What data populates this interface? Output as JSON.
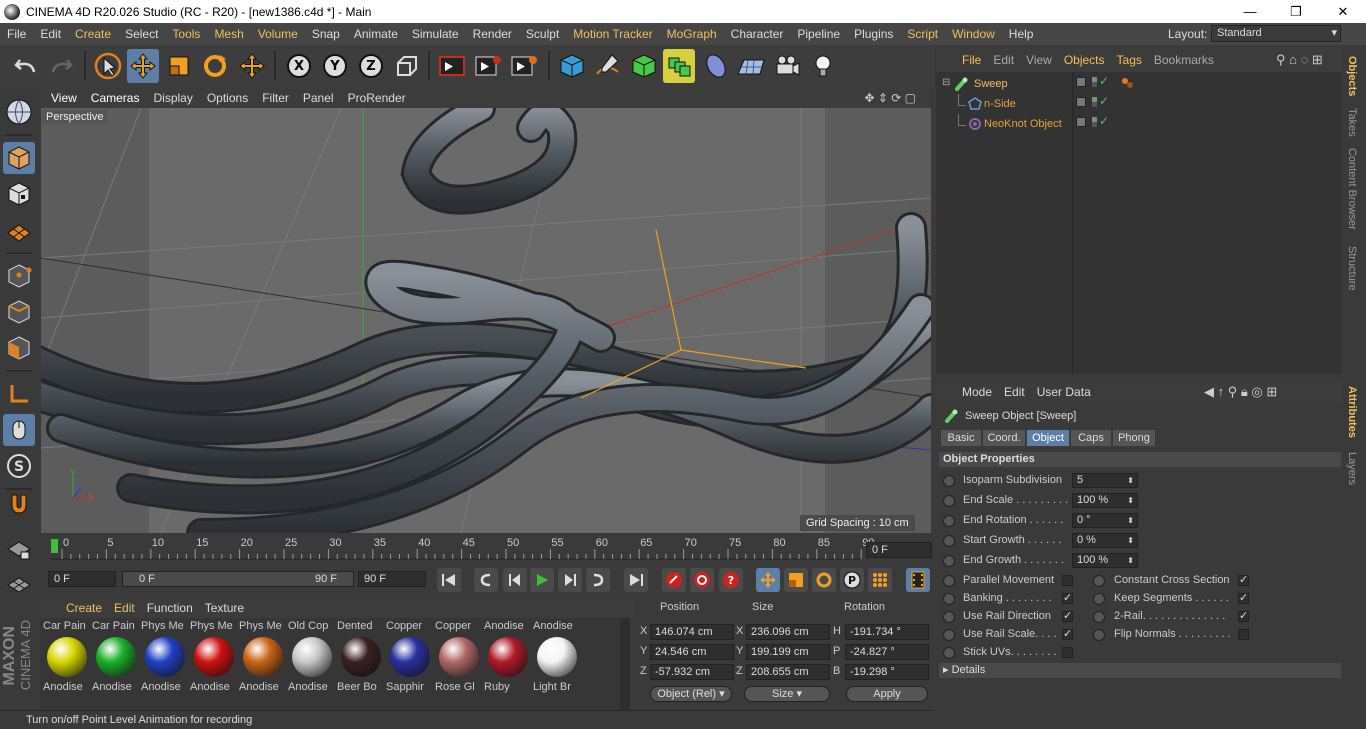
{
  "window": {
    "title": "CINEMA 4D R20.026 Studio (RC - R20) - [new1386.c4d *] - Main",
    "minimize": "—",
    "maximize": "❐",
    "close": "✕"
  },
  "menubar": {
    "items": [
      "File",
      "Edit",
      "Create",
      "Select",
      "Tools",
      "Mesh",
      "Volume",
      "Snap",
      "Animate",
      "Simulate",
      "Render",
      "Sculpt",
      "Motion Tracker",
      "MoGraph",
      "Character",
      "Pipeline",
      "Plugins",
      "Script",
      "Window",
      "Help"
    ],
    "layout_label": "Layout:",
    "layout_value": "Standard"
  },
  "viewport": {
    "menu": [
      "View",
      "Cameras",
      "Display",
      "Options",
      "Filter",
      "Panel",
      "ProRender"
    ],
    "camera_label": "Perspective",
    "grid_spacing": "Grid Spacing : 10 cm",
    "axis_y": "Y",
    "axis_z": "Z",
    "axis_x": "X"
  },
  "timeline": {
    "ticks": [
      "0",
      "5",
      "10",
      "15",
      "20",
      "25",
      "30",
      "35",
      "40",
      "45",
      "50",
      "55",
      "60",
      "65",
      "70",
      "75",
      "80",
      "85",
      "90"
    ],
    "current_frame": "0 F",
    "start_frame": "0 F",
    "range_start": "0 F",
    "range_end": "90 F",
    "end_frame": "90 F"
  },
  "materials": {
    "menu": [
      "Create",
      "Edit",
      "Function",
      "Texture"
    ],
    "items": [
      {
        "top": "Car Pain",
        "bottom": "Anodise",
        "color": "#d6d600"
      },
      {
        "top": "Car Pain",
        "bottom": "Anodise",
        "color": "#18b028"
      },
      {
        "top": "Phys Me",
        "bottom": "Anodise",
        "color": "#2040c8"
      },
      {
        "top": "Phys Me",
        "bottom": "Anodise",
        "color": "#d01010"
      },
      {
        "top": "Phys Me",
        "bottom": "Anodise",
        "color": "#c86414"
      },
      {
        "top": "Old Cop",
        "bottom": "Anodise",
        "color": "#c8c8c8"
      },
      {
        "top": "Dented",
        "bottom": "Beer Bo",
        "color": "#3a2020"
      },
      {
        "top": "Copper",
        "bottom": "Sapphir",
        "color": "#2830a0"
      },
      {
        "top": "Copper",
        "bottom": "Rose Gl",
        "color": "#b06868"
      },
      {
        "top": "Anodise",
        "bottom": "Ruby",
        "color": "#b01828"
      },
      {
        "top": "Anodise",
        "bottom": "Light Br",
        "color": "#f4f4f4"
      }
    ]
  },
  "coordinates": {
    "headers": {
      "position": "Position",
      "size": "Size",
      "rotation": "Rotation"
    },
    "rows": [
      {
        "axis": "X",
        "pos": "146.074 cm",
        "saxis": "X",
        "size": "236.096 cm",
        "raxis": "H",
        "rot": "-191.734 °"
      },
      {
        "axis": "Y",
        "pos": "24.546 cm",
        "saxis": "Y",
        "size": "199.199 cm",
        "raxis": "P",
        "rot": "-24.827 °"
      },
      {
        "axis": "Z",
        "pos": "-57.932 cm",
        "saxis": "Z",
        "size": "208.655 cm",
        "raxis": "B",
        "rot": "-19.298 °"
      }
    ],
    "mode": "Object (Rel)",
    "size_mode": "Size",
    "apply": "Apply"
  },
  "status_text": "Turn on/off Point Level Animation for recording",
  "objects": {
    "menu": [
      "File",
      "Edit",
      "View",
      "Objects",
      "Tags",
      "Bookmarks"
    ],
    "items": [
      {
        "name": "Sweep",
        "color": "#66cc66"
      },
      {
        "name": "n-Side",
        "color": "#6699dd"
      },
      {
        "name": "NeoKnot Object",
        "color": "#8866aa"
      }
    ]
  },
  "attributes": {
    "menu": [
      "Mode",
      "Edit",
      "User Data"
    ],
    "object_title": "Sweep Object [Sweep]",
    "tabs": [
      "Basic",
      "Coord.",
      "Object",
      "Caps",
      "Phong"
    ],
    "active_tab": "Object",
    "section": "Object Properties",
    "fields": [
      {
        "label": "Isoparm Subdivision",
        "value": "5"
      },
      {
        "label": "End Scale . . . . . . . . .",
        "value": "100 %"
      },
      {
        "label": "End Rotation . . . . . .",
        "value": "0 °"
      },
      {
        "label": "Start Growth . . . . . .",
        "value": "0 %"
      },
      {
        "label": "End Growth . . . . . . .",
        "value": "100 %"
      }
    ],
    "checks_left": [
      {
        "label": "Parallel Movement",
        "checked": ""
      },
      {
        "label": "Banking . . . . . . . .",
        "checked": "✓"
      },
      {
        "label": "Use Rail Direction",
        "checked": "✓"
      },
      {
        "label": "Use Rail Scale. . . .",
        "checked": "✓"
      },
      {
        "label": "Stick UVs. . . . . . . .",
        "checked": ""
      }
    ],
    "checks_right": [
      {
        "label": "Constant Cross Section",
        "checked": "✓"
      },
      {
        "label": "Keep Segments . . . . . .",
        "checked": "✓"
      },
      {
        "label": "2-Rail. . . . . . . . . . . . . .",
        "checked": "✓"
      },
      {
        "label": "Flip Normals . . . . . . . . .",
        "checked": ""
      }
    ],
    "details": "Details"
  },
  "side_tabs_top": [
    "Objects",
    "Takes",
    "Content Browser",
    "Structure"
  ],
  "side_tabs_bottom": [
    "Attributes",
    "Layers"
  ],
  "brand": {
    "line1": "MAXON",
    "line2": "CINEMA 4D"
  }
}
